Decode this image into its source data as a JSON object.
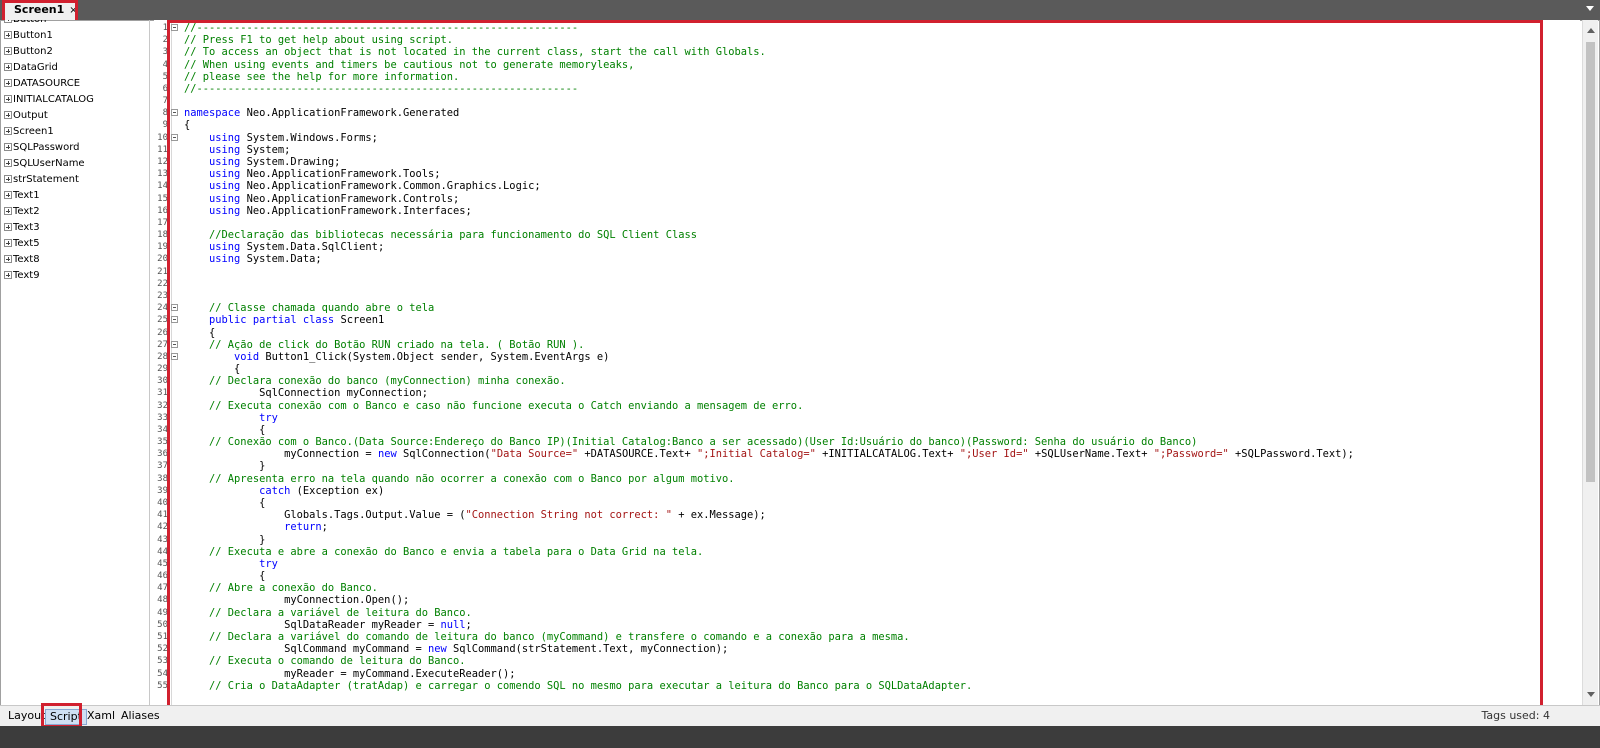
{
  "document_tab": {
    "label": "Screen1",
    "close": "×"
  },
  "tree": {
    "items": [
      "Button",
      "Button1",
      "Button2",
      "DataGrid",
      "DATASOURCE",
      "INITIALCATALOG",
      "Output",
      "Screen1",
      "SQLPassword",
      "SQLUserName",
      "strStatement",
      "Text1",
      "Text2",
      "Text3",
      "Text5",
      "Text8",
      "Text9"
    ]
  },
  "code": {
    "lines": [
      [
        [
          "cm",
          "//-------------------------------------------------------------"
        ]
      ],
      [
        [
          "cm",
          "// Press F1 to get help about using script."
        ]
      ],
      [
        [
          "cm",
          "// To access an object that is not located in the current class, start the call with Globals."
        ]
      ],
      [
        [
          "cm",
          "// When using events and timers be cautious not to generate memoryleaks,"
        ]
      ],
      [
        [
          "cm",
          "// please see the help for more information."
        ]
      ],
      [
        [
          "cm",
          "//-------------------------------------------------------------"
        ]
      ],
      [],
      [
        [
          "kw",
          "namespace"
        ],
        [
          "tx",
          " Neo.ApplicationFramework.Generated"
        ]
      ],
      [
        [
          "tx",
          "{"
        ]
      ],
      [
        [
          "tx",
          "    "
        ],
        [
          "kw",
          "using"
        ],
        [
          "tx",
          " System.Windows.Forms;"
        ]
      ],
      [
        [
          "tx",
          "    "
        ],
        [
          "kw",
          "using"
        ],
        [
          "tx",
          " System;"
        ]
      ],
      [
        [
          "tx",
          "    "
        ],
        [
          "kw",
          "using"
        ],
        [
          "tx",
          " System.Drawing;"
        ]
      ],
      [
        [
          "tx",
          "    "
        ],
        [
          "kw",
          "using"
        ],
        [
          "tx",
          " Neo.ApplicationFramework.Tools;"
        ]
      ],
      [
        [
          "tx",
          "    "
        ],
        [
          "kw",
          "using"
        ],
        [
          "tx",
          " Neo.ApplicationFramework.Common.Graphics.Logic;"
        ]
      ],
      [
        [
          "tx",
          "    "
        ],
        [
          "kw",
          "using"
        ],
        [
          "tx",
          " Neo.ApplicationFramework.Controls;"
        ]
      ],
      [
        [
          "tx",
          "    "
        ],
        [
          "kw",
          "using"
        ],
        [
          "tx",
          " Neo.ApplicationFramework.Interfaces;"
        ]
      ],
      [],
      [
        [
          "tx",
          "    "
        ],
        [
          "cm",
          "//Declaração das bibliotecas necessária para funcionamento do SQL Client Class"
        ]
      ],
      [
        [
          "tx",
          "    "
        ],
        [
          "kw",
          "using"
        ],
        [
          "tx",
          " System.Data.SqlClient;"
        ]
      ],
      [
        [
          "tx",
          "    "
        ],
        [
          "kw",
          "using"
        ],
        [
          "tx",
          " System.Data;"
        ]
      ],
      [],
      [],
      [],
      [
        [
          "tx",
          "    "
        ],
        [
          "cm",
          "// Classe chamada quando abre o tela"
        ]
      ],
      [
        [
          "tx",
          "    "
        ],
        [
          "kw",
          "public"
        ],
        [
          "tx",
          " "
        ],
        [
          "kw",
          "partial"
        ],
        [
          "tx",
          " "
        ],
        [
          "kw",
          "class"
        ],
        [
          "tx",
          " Screen1"
        ]
      ],
      [
        [
          "tx",
          "    {"
        ]
      ],
      [
        [
          "tx",
          "    "
        ],
        [
          "cm",
          "// Ação de click do Botão RUN criado na tela. ( Botão RUN )."
        ]
      ],
      [
        [
          "tx",
          "        "
        ],
        [
          "kw",
          "void"
        ],
        [
          "tx",
          " Button1_Click(System.Object sender, System.EventArgs e)"
        ]
      ],
      [
        [
          "tx",
          "        {"
        ]
      ],
      [
        [
          "tx",
          "    "
        ],
        [
          "cm",
          "// Declara conexão do banco (myConnection) minha conexão."
        ]
      ],
      [
        [
          "tx",
          "            SqlConnection myConnection;"
        ]
      ],
      [
        [
          "tx",
          "    "
        ],
        [
          "cm",
          "// Executa conexão com o Banco e caso não funcione executa o Catch enviando a mensagem de erro."
        ]
      ],
      [
        [
          "tx",
          "            "
        ],
        [
          "kw",
          "try"
        ]
      ],
      [
        [
          "tx",
          "            {"
        ]
      ],
      [
        [
          "tx",
          "    "
        ],
        [
          "cm",
          "// Conexão com o Banco.(Data Source:Endereço do Banco IP)(Initial Catalog:Banco a ser acessado)(User Id:Usuário do banco)(Password: Senha do usuário do Banco)"
        ]
      ],
      [
        [
          "tx",
          "                myConnection = "
        ],
        [
          "kw",
          "new"
        ],
        [
          "tx",
          " SqlConnection("
        ],
        [
          "st",
          "\"Data Source=\""
        ],
        [
          "tx",
          " +DATASOURCE.Text+ "
        ],
        [
          "st",
          "\";Initial Catalog=\""
        ],
        [
          "tx",
          " +INITIALCATALOG.Text+ "
        ],
        [
          "st",
          "\";User Id=\""
        ],
        [
          "tx",
          " +SQLUserName.Text+ "
        ],
        [
          "st",
          "\";Password=\""
        ],
        [
          "tx",
          " +SQLPassword.Text);"
        ]
      ],
      [
        [
          "tx",
          "            }"
        ]
      ],
      [
        [
          "tx",
          "    "
        ],
        [
          "cm",
          "// Apresenta erro na tela quando não ocorrer a conexão com o Banco por algum motivo."
        ]
      ],
      [
        [
          "tx",
          "            "
        ],
        [
          "kw",
          "catch"
        ],
        [
          "tx",
          " (Exception ex)"
        ]
      ],
      [
        [
          "tx",
          "            {"
        ]
      ],
      [
        [
          "tx",
          "                Globals.Tags.Output.Value = ("
        ],
        [
          "st",
          "\"Connection String not correct: \""
        ],
        [
          "tx",
          " + ex.Message);"
        ]
      ],
      [
        [
          "tx",
          "                "
        ],
        [
          "kw",
          "return"
        ],
        [
          "tx",
          ";"
        ]
      ],
      [
        [
          "tx",
          "            }"
        ]
      ],
      [
        [
          "tx",
          "    "
        ],
        [
          "cm",
          "// Executa e abre a conexão do Banco e envia a tabela para o Data Grid na tela."
        ]
      ],
      [
        [
          "tx",
          "            "
        ],
        [
          "kw",
          "try"
        ]
      ],
      [
        [
          "tx",
          "            {"
        ]
      ],
      [
        [
          "tx",
          "    "
        ],
        [
          "cm",
          "// Abre a conexão do Banco."
        ]
      ],
      [
        [
          "tx",
          "                myConnection.Open();"
        ]
      ],
      [
        [
          "tx",
          "    "
        ],
        [
          "cm",
          "// Declara a variável de leitura do Banco."
        ]
      ],
      [
        [
          "tx",
          "                SqlDataReader myReader = "
        ],
        [
          "kw",
          "null"
        ],
        [
          "tx",
          ";"
        ]
      ],
      [
        [
          "tx",
          "    "
        ],
        [
          "cm",
          "// Declara a variável do comando de leitura do banco (myCommand) e transfere o comando e a conexão para a mesma."
        ]
      ],
      [
        [
          "tx",
          "                SqlCommand myCommand = "
        ],
        [
          "kw",
          "new"
        ],
        [
          "tx",
          " SqlCommand(strStatement.Text, myConnection);"
        ]
      ],
      [
        [
          "tx",
          "    "
        ],
        [
          "cm",
          "// Executa o comando de leitura do Banco."
        ]
      ],
      [
        [
          "tx",
          "                myReader = myCommand.ExecuteReader();"
        ]
      ],
      [
        [
          "tx",
          "    "
        ],
        [
          "cm",
          "// Cria o DataAdapter (tratAdap) e carregar o comendo SQL no mesmo para executar a leitura do Banco para o SQLDataAdapter."
        ]
      ]
    ],
    "fold_lines": [
      1,
      8,
      10,
      24,
      25,
      27,
      28
    ]
  },
  "bottom_tabs": [
    "Layout",
    "Script",
    "Xaml",
    "Aliases"
  ],
  "active_bottom_tab": "Script",
  "status": {
    "tags_used": "Tags used: 4"
  },
  "colors": {
    "highlight": "#d1202f",
    "comment": "#008000",
    "keyword": "#0000ff",
    "string": "#a31515"
  }
}
